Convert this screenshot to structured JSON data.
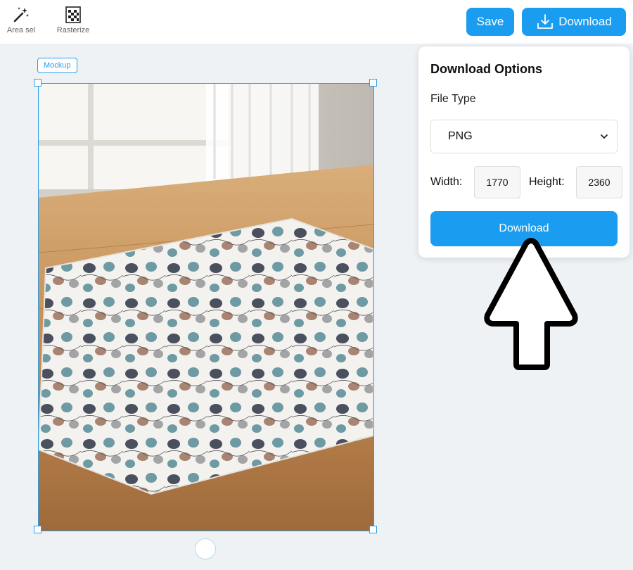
{
  "toolbar": {
    "tools": [
      {
        "label": "Area sel",
        "icon": "magic-wand-icon"
      },
      {
        "label": "Rasterize",
        "icon": "rasterize-grid-icon"
      }
    ],
    "save_label": "Save",
    "download_label": "Download",
    "download_icon": "download-tray-icon"
  },
  "canvas": {
    "layer_tag": "Mockup",
    "image_description": "patterned floor mat on wooden floor",
    "accent_color": "#2b9de8"
  },
  "download_panel": {
    "title": "Download Options",
    "file_type_label": "File Type",
    "file_type_value": "PNG",
    "width_label": "Width:",
    "width_value": "1770",
    "height_label": "Height:",
    "height_value": "2360",
    "download_button_label": "Download",
    "button_color": "#1a9df1"
  },
  "annotation": {
    "arrow_icon": "pointer-arrow-up-icon"
  }
}
